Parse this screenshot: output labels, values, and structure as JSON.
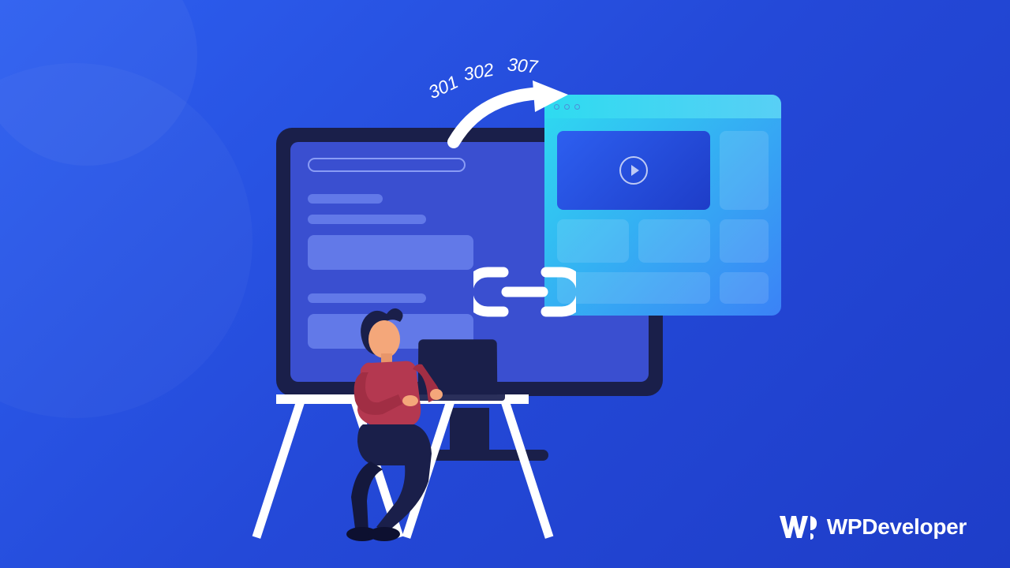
{
  "redirect_codes": [
    "301",
    "302",
    "307"
  ],
  "brand": {
    "name": "WPDeveloper"
  },
  "icons": {
    "arrow": "arrow-icon",
    "link": "link-chain-icon",
    "play": "play-icon"
  }
}
